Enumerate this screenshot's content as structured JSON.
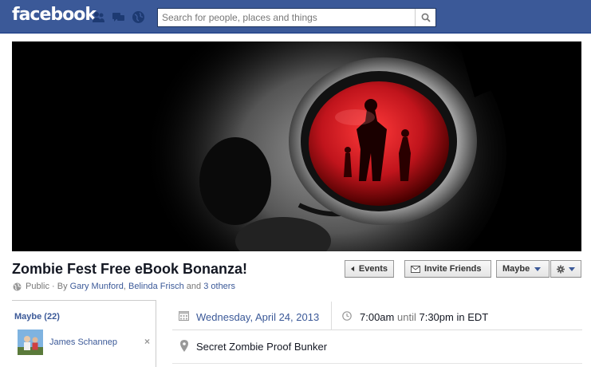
{
  "header": {
    "logo": "facebook",
    "search_placeholder": "Search for people, places and things",
    "jewels": [
      "friend-requests-icon",
      "messages-icon",
      "notifications-icon"
    ]
  },
  "colors": {
    "brand_blue": "#3b5998",
    "link_blue": "#3b5998",
    "cover_red": "#c0141c"
  },
  "event": {
    "title": "Zombie Fest Free eBook Bonanza!",
    "privacy": "Public",
    "by_prefix": "· By",
    "host1": "Gary Munford",
    "comma": ",",
    "host2": "Belinda Frisch",
    "and": "and",
    "others": "3 others",
    "date": "Wednesday, April 24, 2013",
    "start_time": "7:00am",
    "until": "until",
    "end_time": "7:30pm",
    "tz": "in EDT",
    "location": "Secret Zombie Proof Bunker"
  },
  "actions": {
    "events_label": "Events",
    "invite_label": "Invite Friends",
    "rsvp_label": "Maybe"
  },
  "guests": {
    "maybe_header": "Maybe (22)",
    "list": [
      {
        "name": "James Schannep",
        "remove": "×"
      }
    ]
  }
}
